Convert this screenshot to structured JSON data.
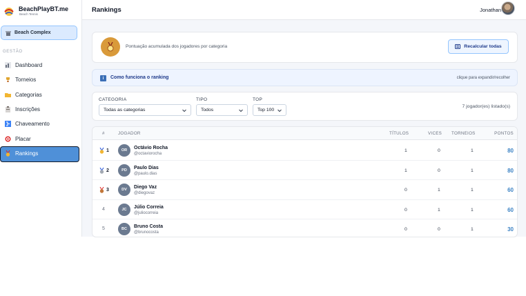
{
  "brand": {
    "name": "BeachPlayBT.me",
    "sub": "Beach Tennis"
  },
  "complex": {
    "label": "Beach Complex"
  },
  "sidebar": {
    "section": "GESTÃO",
    "items": [
      {
        "label": "Dashboard",
        "icon": "chart-icon"
      },
      {
        "label": "Torneios",
        "icon": "trophy-icon"
      },
      {
        "label": "Categorias",
        "icon": "folder-icon"
      },
      {
        "label": "Inscrições",
        "icon": "clipboard-icon"
      },
      {
        "label": "Chaveamento",
        "icon": "bracket-icon"
      },
      {
        "label": "Placar",
        "icon": "target-icon"
      },
      {
        "label": "Rankings",
        "icon": "medal-icon",
        "active": true
      }
    ]
  },
  "header": {
    "title": "Rankings",
    "user": "Jonathan"
  },
  "summary": {
    "subtitle": "Pontuação acumulada dos jogadores por categoria",
    "recalc_label": "Recalcular todas"
  },
  "info": {
    "title": "Como funciona o ranking",
    "hint": "clique para expandir/recolher"
  },
  "filters": {
    "categoria": {
      "label": "CATEGORIA",
      "value": "Todas as categorias"
    },
    "tipo": {
      "label": "TIPO",
      "value": "Todos"
    },
    "top": {
      "label": "TOP",
      "value": "Top 100"
    },
    "count": "7 jogador(es) listado(s)"
  },
  "table": {
    "headers": {
      "rank": "#",
      "player": "JOGADOR",
      "titles": "TÍTULOS",
      "vices": "VICES",
      "tournaments": "TORNEIOS",
      "points": "PONTOS"
    },
    "rows": [
      {
        "rank": "1",
        "initials": "OR",
        "name": "Octávio Rocha",
        "user": "@octaviorocha",
        "titles": "1",
        "vices": "0",
        "tournaments": "1",
        "points": "80"
      },
      {
        "rank": "2",
        "initials": "PD",
        "name": "Paulo Dias",
        "user": "@paulo.dias",
        "titles": "1",
        "vices": "0",
        "tournaments": "1",
        "points": "80"
      },
      {
        "rank": "3",
        "initials": "DV",
        "name": "Diego Vaz",
        "user": "@diegovaz",
        "titles": "0",
        "vices": "1",
        "tournaments": "1",
        "points": "60"
      },
      {
        "rank": "4",
        "initials": "JC",
        "name": "Júlio Correia",
        "user": "@juliocorreia",
        "titles": "0",
        "vices": "1",
        "tournaments": "1",
        "points": "60"
      },
      {
        "rank": "5",
        "initials": "BC",
        "name": "Bruno Costa",
        "user": "@brunocosta",
        "titles": "0",
        "vices": "0",
        "tournaments": "1",
        "points": "30"
      }
    ]
  },
  "colors": {
    "accent": "#4f90d8",
    "points": "#3b82c4",
    "medal": "#d99a3a"
  }
}
